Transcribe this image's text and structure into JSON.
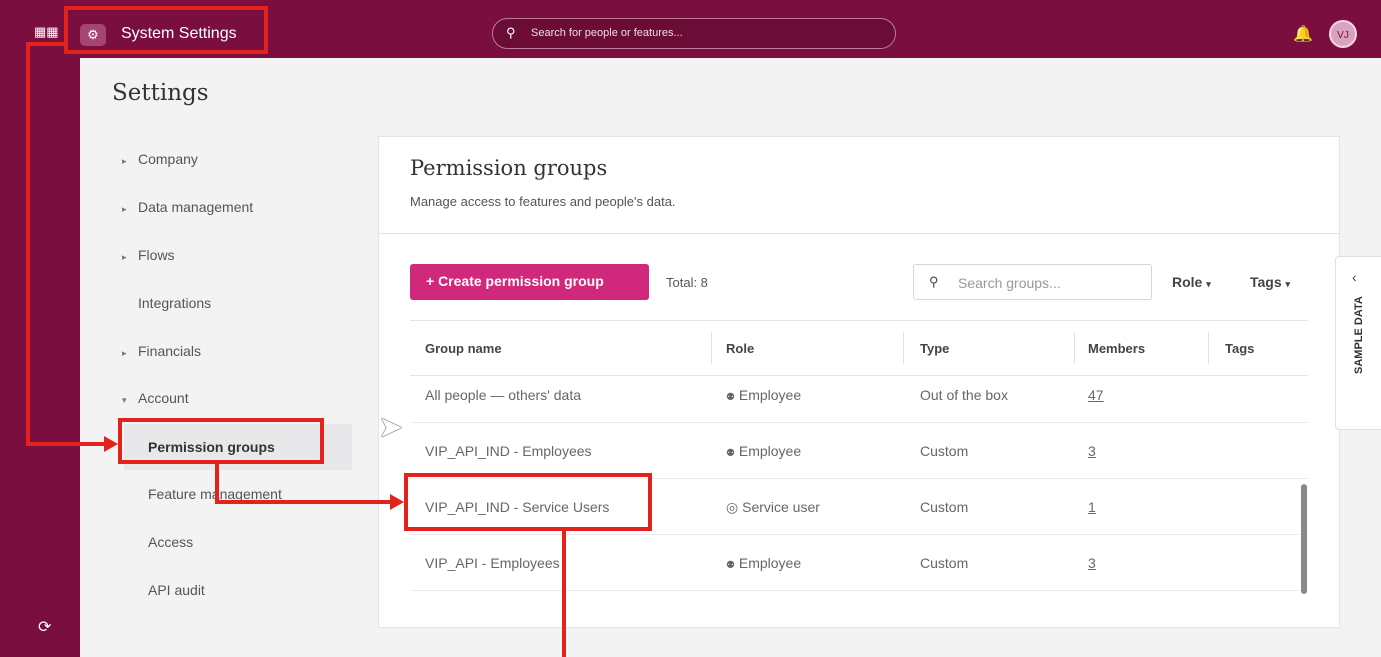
{
  "topbar": {
    "app_title": "System Settings",
    "search_placeholder": "Search for people or features...",
    "avatar_initials": "VJ"
  },
  "page_title": "Settings",
  "sidebar": {
    "items": [
      {
        "label": "Company",
        "expanded": false
      },
      {
        "label": "Data management",
        "expanded": false
      },
      {
        "label": "Flows",
        "expanded": false
      },
      {
        "label": "Integrations"
      },
      {
        "label": "Financials",
        "expanded": false
      },
      {
        "label": "Account",
        "expanded": true
      }
    ],
    "account_children": [
      {
        "label": "Permission groups",
        "active": true
      },
      {
        "label": "Feature management"
      },
      {
        "label": "Access"
      },
      {
        "label": "API audit"
      }
    ]
  },
  "card": {
    "title": "Permission groups",
    "subtitle": "Manage access to features and people's data.",
    "create_button": "+ Create permission group",
    "total": "Total: 8",
    "search_placeholder": "Search groups...",
    "filters": [
      "Role",
      "Tags"
    ]
  },
  "table": {
    "headers": [
      "Group name",
      "Role",
      "Type",
      "Members",
      "Tags"
    ],
    "rows": [
      {
        "name": "All people — others' data",
        "role": "Employee",
        "type": "Out of the box",
        "members": "47"
      },
      {
        "name": "VIP_API_IND - Employees",
        "role": "Employee",
        "type": "Custom",
        "members": "3"
      },
      {
        "name": "VIP_API_IND - Service Users",
        "role": "Service user",
        "type": "Custom",
        "members": "1"
      },
      {
        "name": "VIP_API - Employees",
        "role": "Employee",
        "type": "Custom",
        "members": "3"
      }
    ]
  },
  "sample_tab": "SAMPLE DATA",
  "colors": {
    "brand": "#7a0e3e",
    "accent": "#d0287a",
    "annotation": "#e3221c"
  }
}
